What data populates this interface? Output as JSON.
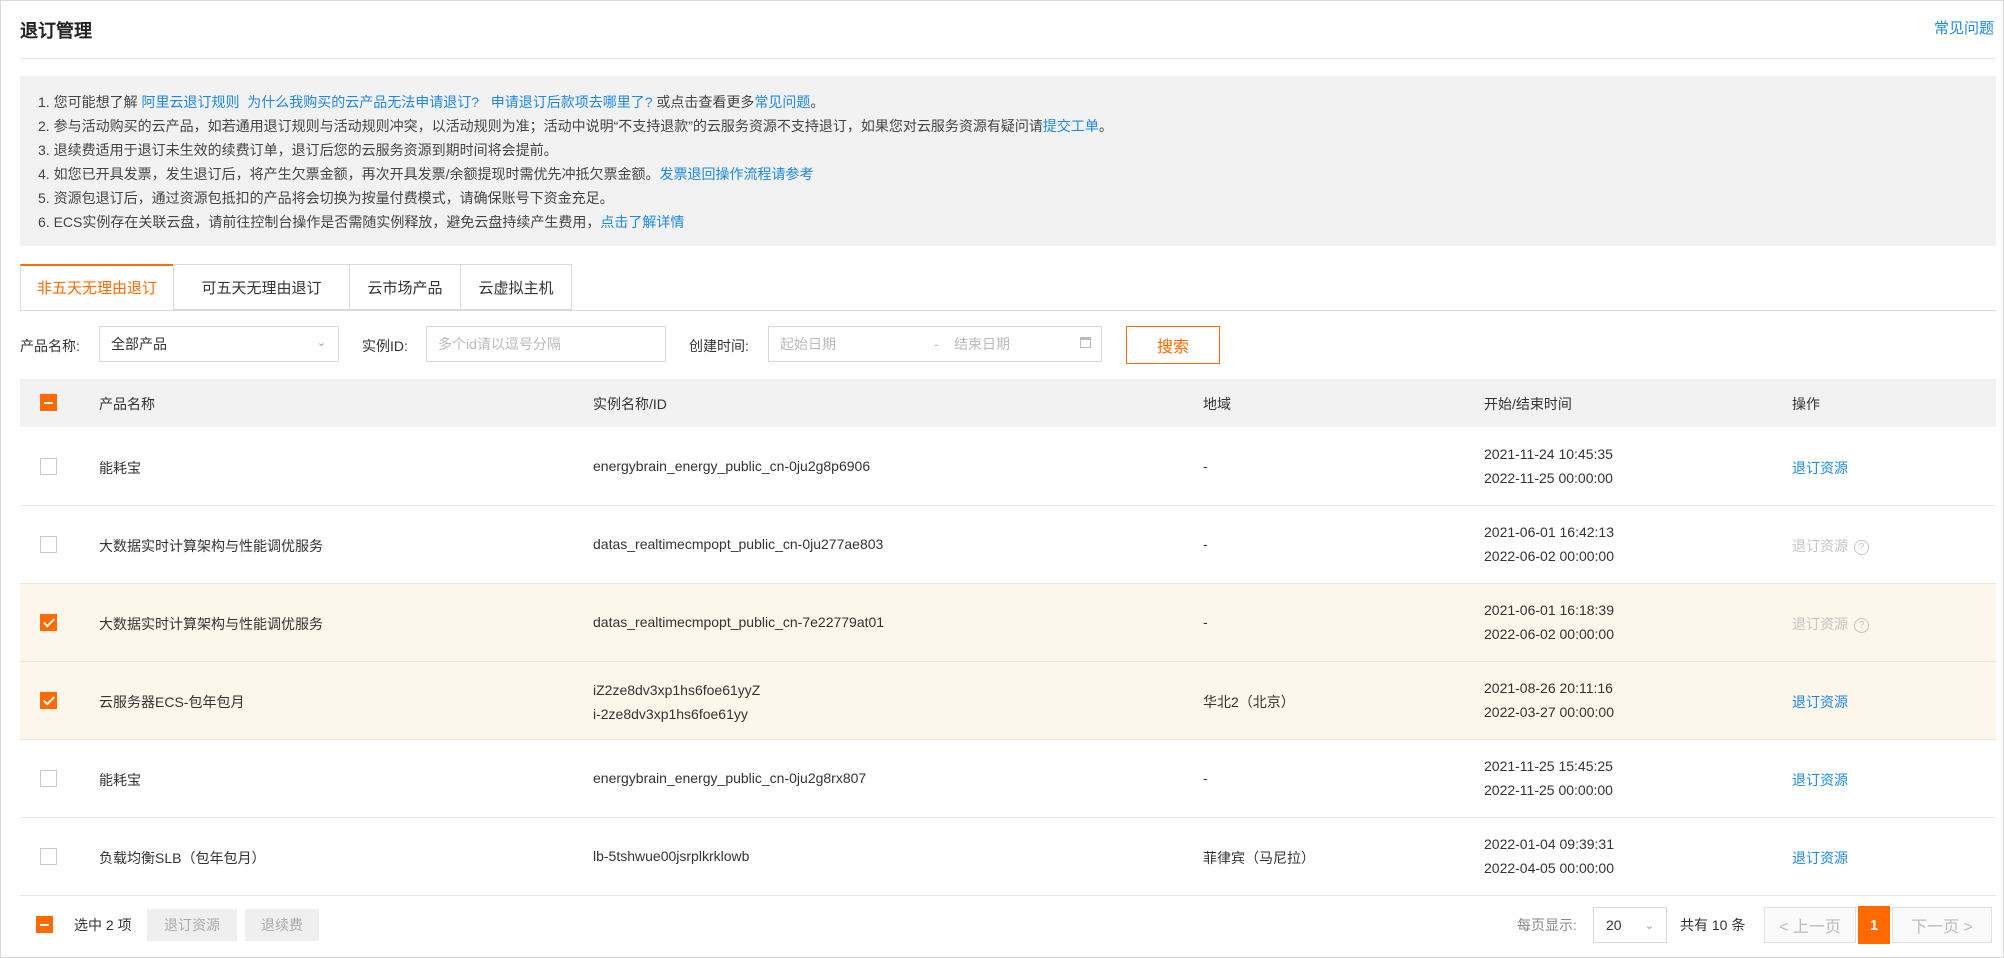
{
  "header": {
    "title": "退订管理",
    "faq": "常见问题"
  },
  "notice": {
    "line1": {
      "prefix": "1. 您可能想了解 ",
      "link1": "阿里云退订规则",
      "link2": "为什么我购买的云产品无法申请退订?",
      "link3": "申请退订后款项去哪里了?",
      "middle": " 或点击查看更多",
      "link4": "常见问题",
      "suffix": "。"
    },
    "line2": {
      "text": "2. 参与活动购买的云产品，如若通用退订规则与活动规则冲突，以活动规则为准；活动中说明“不支持退款”的云服务资源不支持退订，如果您对云服务资源有疑问请",
      "link": "提交工单",
      "suffix": "。"
    },
    "line3": {
      "text": "3. 退续费适用于退订未生效的续费订单，退订后您的云服务资源到期时间将会提前。"
    },
    "line4": {
      "text": "4. 如您已开具发票，发生退订后，将产生欠票金额，再次开具发票/余额提现时需优先冲抵欠票金额。",
      "link": "发票退回操作流程请参考"
    },
    "line5": {
      "text": "5. 资源包退订后，通过资源包抵扣的产品将会切换为按量付费模式，请确保账号下资金充足。"
    },
    "line6": {
      "text": "6. ECS实例存在关联云盘，请前往控制台操作是否需随实例释放，避免云盘持续产生费用，",
      "link": "点击了解详情"
    }
  },
  "tabs": [
    "非五天无理由退订",
    "可五天无理由退订",
    "云市场产品",
    "云虚拟主机"
  ],
  "filters": {
    "product_label": "产品名称:",
    "product_value": "全部产品",
    "instance_label": "实例ID:",
    "instance_placeholder": "多个id请以逗号分隔",
    "created_label": "创建时间:",
    "start_placeholder": "起始日期",
    "date_separator": "-",
    "end_placeholder": "结束日期",
    "search": "搜索"
  },
  "table": {
    "columns": [
      "产品名称",
      "实例名称/ID",
      "地域",
      "开始/结束时间",
      "操作"
    ],
    "rows": [
      {
        "checked": false,
        "product": "能耗宝",
        "instance": [
          "energybrain_energy_public_cn-0ju2g8p6906"
        ],
        "region": "-",
        "start": "2021-11-24 10:45:35",
        "end": "2022-11-25 00:00:00",
        "action": "退订资源",
        "disabled": false
      },
      {
        "checked": false,
        "product": "大数据实时计算架构与性能调优服务",
        "instance": [
          "datas_realtimecmpopt_public_cn-0ju277ae803"
        ],
        "region": "-",
        "start": "2021-06-01 16:42:13",
        "end": "2022-06-02 00:00:00",
        "action": "退订资源",
        "disabled": true
      },
      {
        "checked": true,
        "product": "大数据实时计算架构与性能调优服务",
        "instance": [
          "datas_realtimecmpopt_public_cn-7e22779at01"
        ],
        "region": "-",
        "start": "2021-06-01 16:18:39",
        "end": "2022-06-02 00:00:00",
        "action": "退订资源",
        "disabled": true
      },
      {
        "checked": true,
        "product": "云服务器ECS-包年包月",
        "instance": [
          "iZ2ze8dv3xp1hs6foe61yyZ",
          "i-2ze8dv3xp1hs6foe61yy"
        ],
        "region": "华北2（北京）",
        "start": "2021-08-26 20:11:16",
        "end": "2022-03-27 00:00:00",
        "action": "退订资源",
        "disabled": false
      },
      {
        "checked": false,
        "product": "能耗宝",
        "instance": [
          "energybrain_energy_public_cn-0ju2g8rx807"
        ],
        "region": "-",
        "start": "2021-11-25 15:45:25",
        "end": "2022-11-25 00:00:00",
        "action": "退订资源",
        "disabled": false
      },
      {
        "checked": false,
        "product": "负载均衡SLB（包年包月）",
        "instance": [
          "lb-5tshwue00jsrplkrklowb"
        ],
        "region": "菲律宾（马尼拉）",
        "start": "2022-01-04 09:39:31",
        "end": "2022-04-05 00:00:00",
        "action": "退订资源",
        "disabled": false
      }
    ]
  },
  "footer": {
    "selected": "选中 2 项",
    "unsubscribe": "退订资源",
    "refund_renewal": "退续费",
    "page_size_label": "每页显示:",
    "page_size": "20",
    "total": "共有 10 条",
    "prev": "< 上一页",
    "current_page": "1",
    "next": "下一页 >"
  },
  "colors": {
    "accent": "#ff6a00",
    "link": "#1e88e5",
    "selected_row": "#fdf6ea"
  }
}
